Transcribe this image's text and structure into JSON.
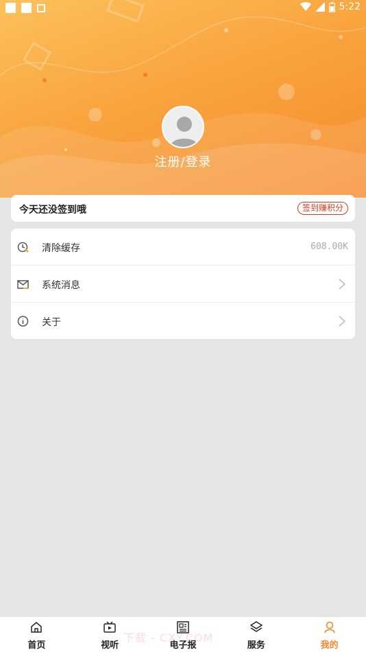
{
  "status_bar": {
    "time": "5:22"
  },
  "profile": {
    "login_text": "注册/登录"
  },
  "checkin": {
    "text": "今天还没签到哦",
    "button_label": "签到赚积分"
  },
  "menu": {
    "items": [
      {
        "label": "清除缓存",
        "value": "608.00K",
        "icon": "clock-broom-icon"
      },
      {
        "label": "系统消息",
        "icon": "mail-icon"
      },
      {
        "label": "关于",
        "icon": "info-icon"
      }
    ]
  },
  "tabbar": {
    "items": [
      {
        "label": "首页",
        "icon": "home-icon"
      },
      {
        "label": "视听",
        "icon": "tv-play-icon"
      },
      {
        "label": "电子报",
        "icon": "newspaper-icon"
      },
      {
        "label": "服务",
        "icon": "layers-icon"
      },
      {
        "label": "我的",
        "icon": "user-icon",
        "active": true
      }
    ]
  },
  "watermark": "下载 - CXY.COM",
  "colors": {
    "accent": "#f5872a",
    "checkin_red": "#d8391f",
    "background": "#e5e5e5"
  }
}
